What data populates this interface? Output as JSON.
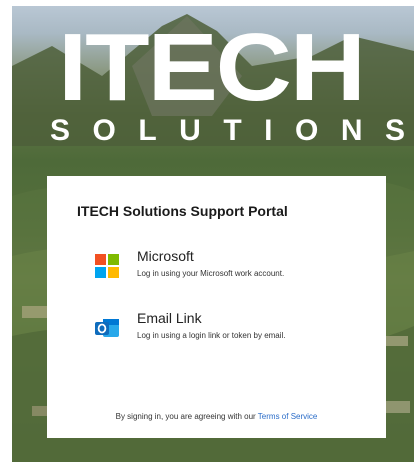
{
  "logo": {
    "line1": "ITECH",
    "line2": "SOLUTIONS"
  },
  "portal": {
    "title": "ITECH Solutions Support Portal",
    "options": [
      {
        "name": "Microsoft",
        "description": "Log in using your Microsoft work account.",
        "icon": "microsoft-icon"
      },
      {
        "name": "Email Link",
        "description": "Log in using a login link or token by email.",
        "icon": "outlook-icon"
      }
    ],
    "footer_text": "By signing in, you are agreeing with our",
    "terms_link": "Terms of Service"
  },
  "colors": {
    "link": "#2a6cc8",
    "ms_red": "#f25022",
    "ms_green": "#7fba00",
    "ms_blue": "#00a4ef",
    "ms_yellow": "#ffb900",
    "outlook_blue": "#0f6cbd"
  }
}
